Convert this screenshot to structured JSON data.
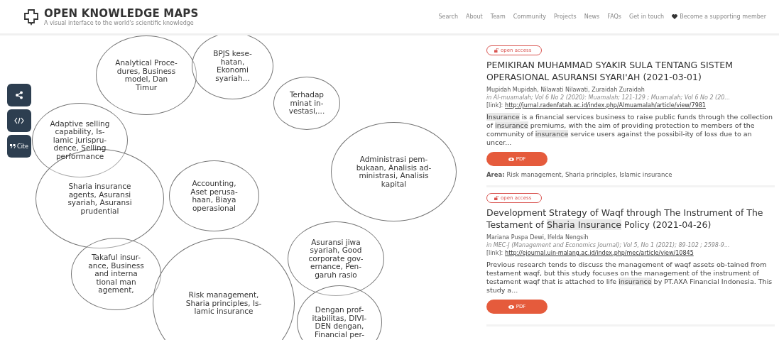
{
  "header": {
    "title": "OPEN KNOWLEDGE MAPS",
    "subtitle": "A visual interface to the world's scientific knowledge",
    "nav": [
      "Search",
      "About",
      "Team",
      "Community",
      "Projects",
      "News",
      "FAQs",
      "Get in touch"
    ],
    "support": "Become a supporting member"
  },
  "side_buttons": [
    {
      "kind": "share"
    },
    {
      "kind": "embed"
    },
    {
      "kind": "cite",
      "label": "Cite"
    }
  ],
  "bubbles": [
    {
      "lines": [
        "Analytical Proce-",
        "dures, Business",
        "model, Dan",
        "Timur"
      ]
    },
    {
      "lines": [
        "BPJS kese-",
        "hatan,",
        "Ekonomi",
        "syariah..."
      ]
    },
    {
      "lines": [
        "Terhadap",
        "minat in-",
        "vestasi,..."
      ]
    },
    {
      "lines": [
        "Adaptive selling",
        "capability, Is-",
        "lamic jurispru-",
        "dence, Selling",
        "performance"
      ]
    },
    {
      "lines": [
        "Sharia insurance",
        "agents, Asuransi",
        "syariah, Asuransi",
        "prudential"
      ]
    },
    {
      "lines": [
        "Accounting,",
        "Aset perusa-",
        "haan, Biaya",
        "operasional"
      ]
    },
    {
      "lines": [
        "Administrasi pem-",
        "bukaan, Analisis ad-",
        "ministrasi, Analisis",
        "kapital"
      ]
    },
    {
      "lines": [
        "Takaful insur-",
        "ance, Business",
        "and interna",
        "tional man",
        "agement,"
      ]
    },
    {
      "lines": [
        "Risk management,",
        "Sharia principles, Is-",
        "lamic insurance"
      ]
    },
    {
      "lines": [
        "Asuransi jiwa",
        "syariah, Good",
        "corporate gov-",
        "ernance, Pen-",
        "garuh rasio"
      ]
    },
    {
      "lines": [
        "Dengan prof-",
        "itabilitas, DIVI-",
        "DEN dengan,",
        "Financial per-"
      ]
    }
  ],
  "papers": [
    {
      "badge": "open access",
      "title": [
        {
          "text": "PEMIKIRAN MUHAMMAD SYAKIR SULA TENTANG SISTEM OPERASIONAL ASURANSI SYARI'AH (2021-03-01)",
          "highlight": false
        }
      ],
      "authors": "Mupidah Mupidah, Nilawati Nilawati, Zuraidah Zuraidah",
      "source": "in Al-muamalah; Vol 6 No 2 (2020): Muamalah; 121-129 ; Muamalah; Vol 6 No 2 (20...",
      "link_label": "[link]:",
      "url": "http://jurnal.radenfatah.ac.id/index.php/Almuamalah/article/view/7981",
      "abstract": [
        {
          "text": "Insurance",
          "highlight": true
        },
        {
          "text": " is a financial services business to raise public funds through the collection of ",
          "highlight": false
        },
        {
          "text": "insurance",
          "highlight": true
        },
        {
          "text": " premiums, with the aim of providing protection to members of the community of ",
          "highlight": false
        },
        {
          "text": "insurance",
          "highlight": true
        },
        {
          "text": " service users against the possibil-ity of loss due to an uncer...",
          "highlight": false
        }
      ],
      "pdf": "PDF",
      "area_label": "Area:",
      "area": "Risk management, Sharia principles, Islamic insurance"
    },
    {
      "badge": "open access",
      "title": [
        {
          "text": "Development Strategy of Waqf through The Instrument of The Testament of ",
          "highlight": false
        },
        {
          "text": "Sharia Insurance",
          "highlight": true
        },
        {
          "text": " Policy (2021-04-26)",
          "highlight": false
        }
      ],
      "authors": "Mariana Puspa Dewi, Ifelda Nengsih",
      "source": "in MEC-J (Management and Economics Journal); Vol 5, No 1 (2021); 89-102 ; 2598-9...",
      "link_label": "[link]:",
      "url": "http://ejournal.uin-malang.ac.id/index.php/mec/article/view/10845",
      "abstract": [
        {
          "text": "Previous research tends to discuss the management of waqf assets ob-tained from testament waqf, but this study focuses on the management of the instrument of testament waqf that is attached to life ",
          "highlight": false
        },
        {
          "text": "insurance",
          "highlight": true
        },
        {
          "text": " by PT.AXA Financial Indonesia. This study a...",
          "highlight": false
        }
      ],
      "pdf": "PDF"
    }
  ]
}
